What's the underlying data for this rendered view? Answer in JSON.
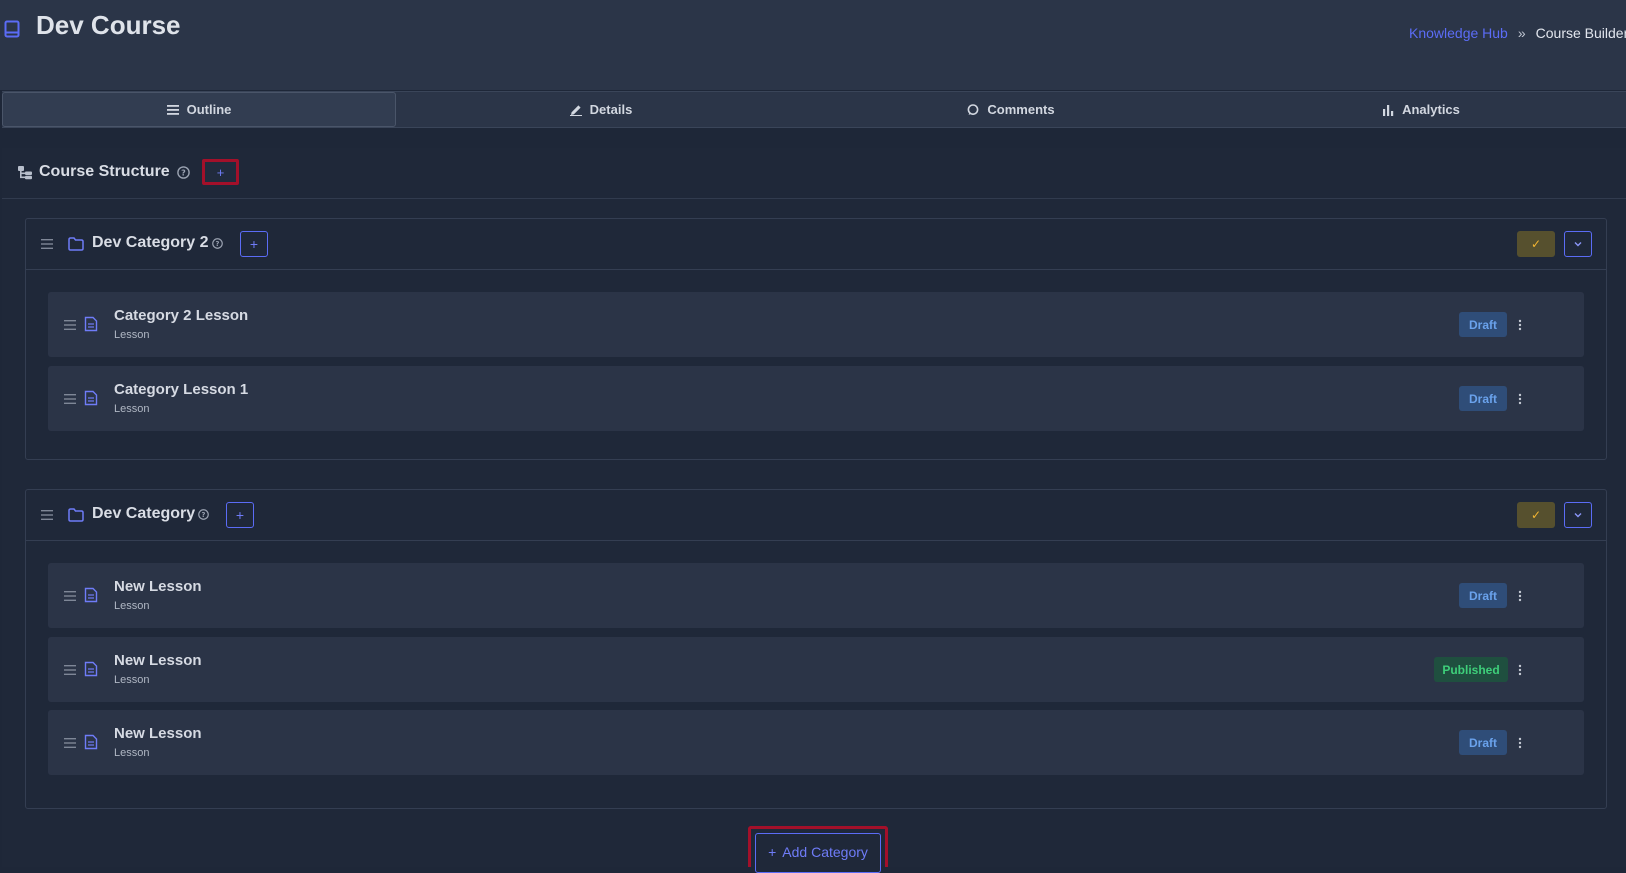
{
  "header": {
    "title": "Dev Course",
    "breadcrumb": {
      "link": "Knowledge Hub",
      "separator": "»",
      "current": "Course Builder"
    }
  },
  "tabs": [
    {
      "label": "Outline",
      "icon": "list-icon",
      "active": true
    },
    {
      "label": "Details",
      "icon": "pencil-icon",
      "active": false
    },
    {
      "label": "Comments",
      "icon": "comment-icon",
      "active": false
    },
    {
      "label": "Analytics",
      "icon": "bar-chart-icon",
      "active": false
    }
  ],
  "structure": {
    "title": "Course Structure",
    "add_label": "+"
  },
  "categories": [
    {
      "title": "Dev Category 2",
      "add_label": "+",
      "check_label": "✓",
      "lessons": [
        {
          "title": "Category 2 Lesson",
          "type": "Lesson",
          "status": "Draft"
        },
        {
          "title": "Category Lesson 1",
          "type": "Lesson",
          "status": "Draft"
        }
      ]
    },
    {
      "title": "Dev Category",
      "add_label": "+",
      "check_label": "✓",
      "lessons": [
        {
          "title": "New Lesson",
          "type": "Lesson",
          "status": "Draft"
        },
        {
          "title": "New Lesson",
          "type": "Lesson",
          "status": "Published"
        },
        {
          "title": "New Lesson",
          "type": "Lesson",
          "status": "Draft"
        }
      ]
    }
  ],
  "add_category": {
    "icon": "+",
    "label": "Add Category"
  },
  "colors": {
    "accent": "#5b6cf6",
    "draft": "#6aa2ec",
    "published": "#3ecf7a",
    "highlight": "#a3102a"
  }
}
